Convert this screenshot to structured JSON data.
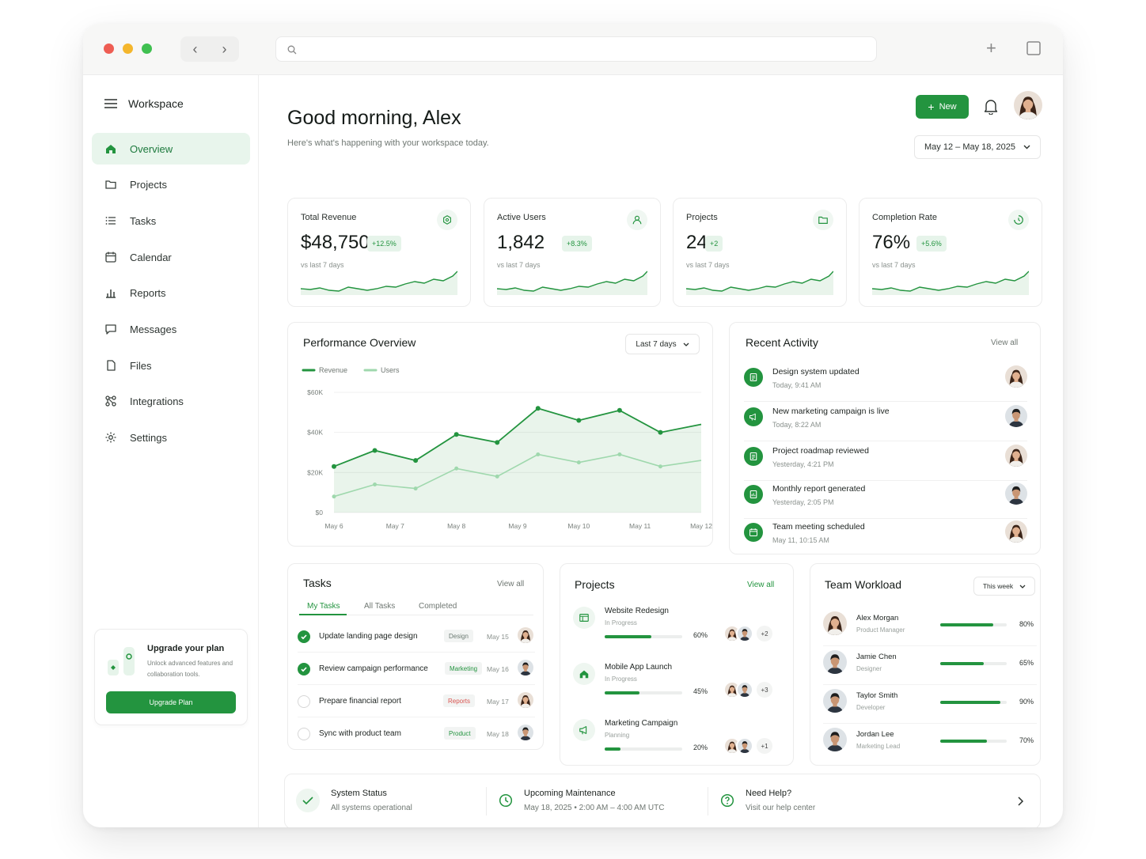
{
  "window": {
    "traffic_colors": {
      "close": "#ee5d53",
      "minimize": "#f4b62c",
      "maximize": "#3fc050"
    },
    "nav_back": "‹",
    "nav_forward": "›",
    "address_placeholder": "",
    "plus_icon": "+"
  },
  "sidebar": {
    "workspace": "Workspace",
    "items": [
      {
        "label": "Overview",
        "icon": "home-icon",
        "active": true
      },
      {
        "label": "Projects",
        "icon": "folder-icon"
      },
      {
        "label": "Tasks",
        "icon": "list-icon"
      },
      {
        "label": "Calendar",
        "icon": "calendar-icon"
      },
      {
        "label": "Reports",
        "icon": "bar-chart-icon"
      },
      {
        "label": "Messages",
        "icon": "message-icon"
      },
      {
        "label": "Files",
        "icon": "file-icon"
      },
      {
        "label": "Integrations",
        "icon": "integrations-icon"
      },
      {
        "label": "Settings",
        "icon": "gear-icon"
      }
    ],
    "upgrade": {
      "title": "Upgrade your plan",
      "subtitle": "Unlock advanced features and collaboration tools.",
      "button": "Upgrade Plan"
    }
  },
  "header": {
    "greeting": "Good morning, Alex",
    "subtitle": "Here's what's happening with your workspace today.",
    "new_button": "New",
    "date_range": "May 12 – May 18, 2025"
  },
  "kpis": [
    {
      "label": "Total Revenue",
      "value": "$48,750",
      "change": "+12.5%",
      "sub": "vs last 7 days",
      "icon": "revenue-icon"
    },
    {
      "label": "Active Users",
      "value": "1,842",
      "change": "+8.3%",
      "sub": "vs last 7 days",
      "icon": "user-icon"
    },
    {
      "label": "Projects",
      "value": "24",
      "change": "+2",
      "sub": "vs last 7 days",
      "icon": "folder-icon"
    },
    {
      "label": "Completion Rate",
      "value": "76%",
      "change": "+5.6%",
      "sub": "vs last 7 days",
      "icon": "progress-icon"
    }
  ],
  "performance": {
    "title": "Performance Overview",
    "range": "Last 7 days"
  },
  "chart_data": {
    "type": "area",
    "title": "Performance Overview",
    "categories": [
      "May 6",
      "May 7",
      "May 8",
      "May 9",
      "May 10",
      "May 11",
      "May 12"
    ],
    "x": [
      0,
      1,
      2,
      3,
      4,
      5,
      6,
      7,
      8,
      9
    ],
    "series": [
      {
        "name": "Revenue",
        "color": "#23943f",
        "values": [
          23,
          31,
          26,
          39,
          35,
          52,
          46,
          51,
          40,
          44
        ]
      },
      {
        "name": "Users",
        "color": "#9fd8ad",
        "values": [
          8,
          14,
          12,
          22,
          18,
          29,
          25,
          29,
          23,
          26
        ]
      }
    ],
    "yticks": [
      "$60K",
      "$40K",
      "$20K",
      "$0"
    ],
    "ylim": [
      0,
      60
    ],
    "grid": true,
    "legend": "top-left"
  },
  "activity": {
    "title": "Recent Activity",
    "view_all": "View all",
    "items": [
      {
        "title": "Design system updated",
        "time": "Today, 9:41 AM",
        "icon": "document-icon",
        "avatar": "f"
      },
      {
        "title": "New marketing campaign is live",
        "time": "Today, 8:22 AM",
        "icon": "megaphone-icon",
        "avatar": "m"
      },
      {
        "title": "Project roadmap reviewed",
        "time": "Yesterday, 4:21 PM",
        "icon": "document-icon",
        "avatar": "f"
      },
      {
        "title": "Monthly report generated",
        "time": "Yesterday, 2:05 PM",
        "icon": "report-icon",
        "avatar": "m"
      },
      {
        "title": "Team meeting scheduled",
        "time": "May 11, 10:15 AM",
        "icon": "calendar-icon",
        "avatar": "f"
      }
    ]
  },
  "tasks": {
    "title": "Tasks",
    "view_all": "View all",
    "tabs": [
      "My Tasks",
      "All Tasks",
      "Completed"
    ],
    "rows": [
      {
        "name": "Update landing page design",
        "tag": "Design",
        "tag_color": "#6b7a72",
        "date": "May 15",
        "done": true
      },
      {
        "name": "Review campaign performance",
        "tag": "Marketing",
        "tag_color": "#23943f",
        "date": "May 16",
        "done": true
      },
      {
        "name": "Prepare financial report",
        "tag": "Reports",
        "tag_color": "#d9534f",
        "date": "May 17",
        "done": false
      },
      {
        "name": "Sync with product team",
        "tag": "Product",
        "tag_color": "#23943f",
        "date": "May 18",
        "done": false
      }
    ]
  },
  "projects": {
    "title": "Projects",
    "view_all": "View all",
    "rows": [
      {
        "name": "Website Redesign",
        "status": "In Progress",
        "progress": 60,
        "pct": "60%",
        "more": "+2",
        "icon": "layout-icon"
      },
      {
        "name": "Mobile App Launch",
        "status": "In Progress",
        "progress": 45,
        "pct": "45%",
        "more": "+3",
        "icon": "home-icon"
      },
      {
        "name": "Marketing Campaign",
        "status": "Planning",
        "progress": 20,
        "pct": "20%",
        "more": "+1",
        "icon": "megaphone-icon"
      }
    ]
  },
  "workload": {
    "title": "Team Workload",
    "range": "This week",
    "rows": [
      {
        "name": "Alex Morgan",
        "role": "Product Manager",
        "level": 80,
        "pct": "80%",
        "avatar": "f"
      },
      {
        "name": "Jamie Chen",
        "role": "Designer",
        "level": 65,
        "pct": "65%",
        "avatar": "m"
      },
      {
        "name": "Taylor Smith",
        "role": "Developer",
        "level": 90,
        "pct": "90%",
        "avatar": "m"
      },
      {
        "name": "Jordan Lee",
        "role": "Marketing Lead",
        "level": 70,
        "pct": "70%",
        "avatar": "m"
      }
    ]
  },
  "status_bar": {
    "system": {
      "title": "System Status",
      "sub": "All systems operational"
    },
    "maintenance": {
      "title": "Upcoming Maintenance",
      "sub": "May 18, 2025  •  2:00 AM – 4:00 AM UTC"
    },
    "help": {
      "title": "Need Help?",
      "sub": "Visit our help center"
    }
  }
}
